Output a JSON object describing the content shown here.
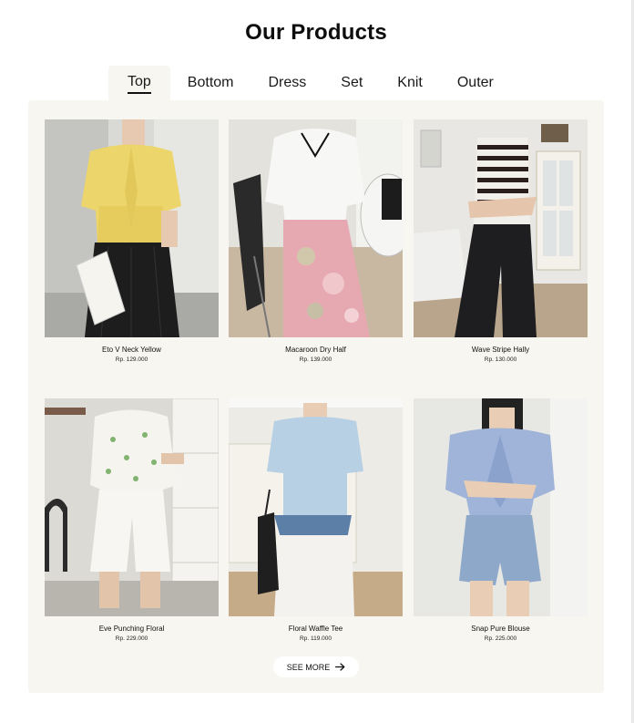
{
  "heading": "Our Products",
  "tabs": [
    {
      "label": "Top",
      "active": true
    },
    {
      "label": "Bottom",
      "active": false
    },
    {
      "label": "Dress",
      "active": false
    },
    {
      "label": "Set",
      "active": false
    },
    {
      "label": "Knit",
      "active": false
    },
    {
      "label": "Outer",
      "active": false
    }
  ],
  "products": [
    {
      "name": "Eto V Neck Yellow",
      "price": "Rp. 129.000"
    },
    {
      "name": "Macaroon Dry Half",
      "price": "Rp. 139.000"
    },
    {
      "name": "Wave Stripe Hally",
      "price": "Rp. 130.000"
    },
    {
      "name": "Eve Punching Floral",
      "price": "Rp. 229.000"
    },
    {
      "name": "Floral Waffle Tee",
      "price": "Rp. 119.000"
    },
    {
      "name": "Snap Pure Blouse",
      "price": "Rp. 225.000"
    }
  ],
  "see_more": {
    "label": "SEE MORE",
    "icon": "arrow-right-icon"
  },
  "colors": {
    "panel_bg": "#f7f6f0",
    "text": "#111111",
    "button_bg": "#ffffff"
  }
}
